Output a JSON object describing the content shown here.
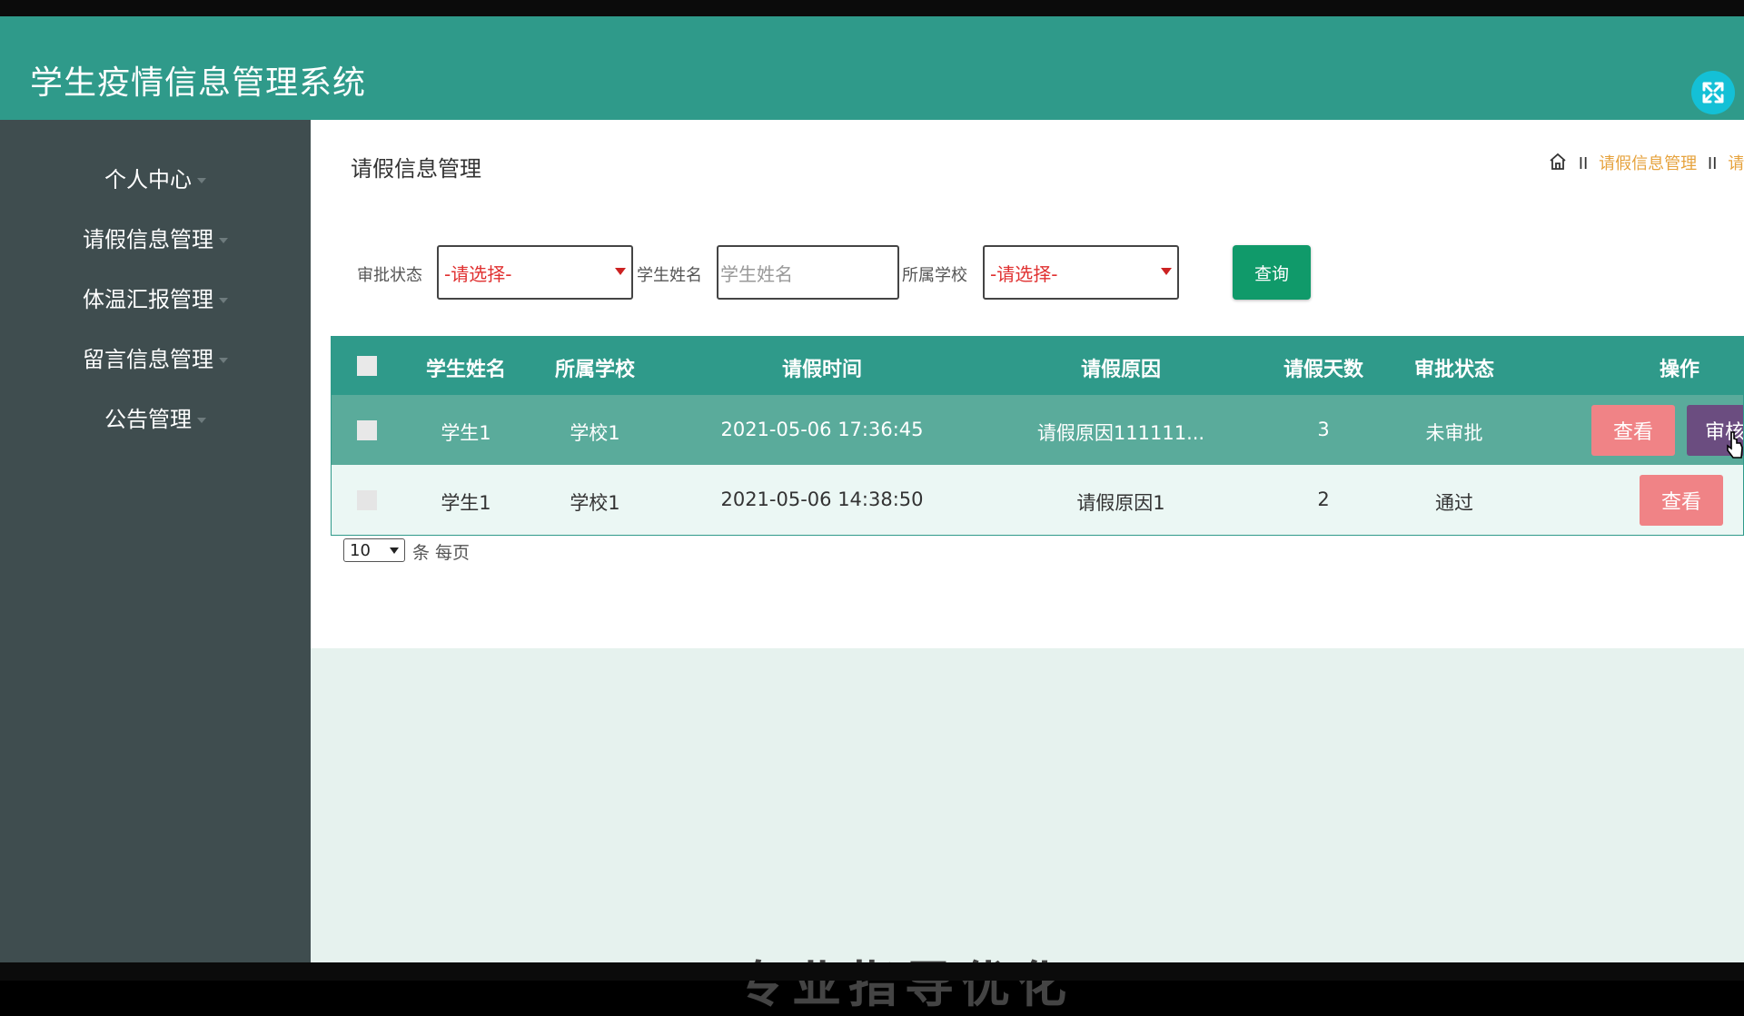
{
  "app": {
    "title": "学生疫情信息管理系统"
  },
  "sidebar": {
    "items": [
      {
        "label": "个人中心"
      },
      {
        "label": "请假信息管理"
      },
      {
        "label": "体温汇报管理"
      },
      {
        "label": "留言信息管理"
      },
      {
        "label": "公告管理"
      }
    ]
  },
  "page": {
    "title": "请假信息管理"
  },
  "breadcrumb": {
    "sep": "II",
    "items": [
      "请假信息管理",
      "请假"
    ]
  },
  "filters": {
    "status_label": "审批状态",
    "status_value": "-请选择-",
    "name_label": "学生姓名",
    "name_placeholder": "学生姓名",
    "school_label": "所属学校",
    "school_value": "-请选择-",
    "query_label": "查询"
  },
  "table": {
    "headers": [
      "学生姓名",
      "所属学校",
      "请假时间",
      "请假原因",
      "请假天数",
      "审批状态",
      "操作"
    ],
    "rows": [
      {
        "name": "学生1",
        "school": "学校1",
        "time": "2021-05-06 17:36:45",
        "reason": "请假原因111111...",
        "days": "3",
        "status": "未审批",
        "view": "查看",
        "review": "审核"
      },
      {
        "name": "学生1",
        "school": "学校1",
        "time": "2021-05-06 14:38:50",
        "reason": "请假原因1",
        "days": "2",
        "status": "通过",
        "view": "查看"
      }
    ]
  },
  "pagination": {
    "page_size": "10",
    "per_page_label": "条 每页"
  },
  "footer_text": "专业指导优化"
}
